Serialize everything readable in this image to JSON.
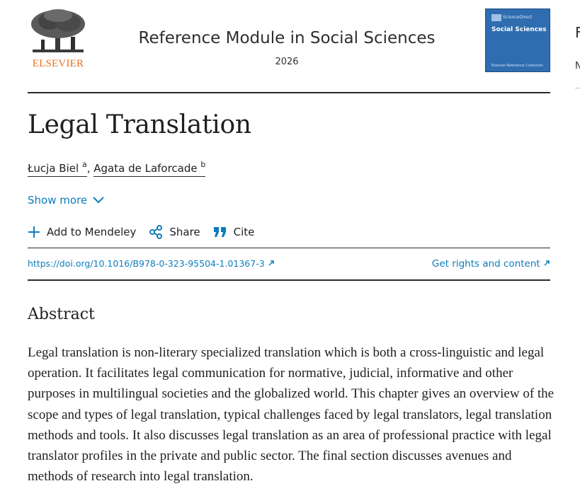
{
  "header": {
    "publisher_logo_text": "ELSEVIER",
    "journal_title": "Reference Module in Social Sciences",
    "year": "2026",
    "cover": {
      "title": "Social Sciences",
      "publisher": "ScienceDirect",
      "collection": "Elsevier Reference Collection"
    },
    "side_heading_initial": "F",
    "side_text_initial": "N"
  },
  "article": {
    "title": "Legal Translation",
    "authors": [
      {
        "name": "Łucja Biel",
        "affiliation": "a"
      },
      {
        "name": "Agata de Laforcade",
        "affiliation": "b"
      }
    ],
    "show_more_label": "Show more",
    "actions": {
      "mendeley": "Add to Mendeley",
      "share": "Share",
      "cite": "Cite"
    },
    "doi_link": "https://doi.org/10.1016/B978-0-323-95504-1.01367-3",
    "rights_link": "Get rights and content"
  },
  "abstract": {
    "heading": "Abstract",
    "body": "Legal translation is non-literary specialized translation which is both a cross-linguistic and legal operation. It facilitates legal communication for normative, judicial, informative and other purposes in multilingual societies and the globalized world. This chapter gives an overview of the scope and types of legal translation, typical challenges faced by legal translators, legal translation methods and tools. It also discusses legal translation as an area of professional practice with legal translator profiles in the private and public sector. The final section discusses avenues and methods of research into legal translation."
  },
  "icons": {
    "logo": "elsevier-tree-logo",
    "chevron": "chevron-down-icon",
    "plus": "plus-icon",
    "share": "share-icon",
    "cite": "quote-icon",
    "external": "external-link-icon"
  },
  "colors": {
    "link": "#0c7dbb",
    "logo_orange": "#e9711c",
    "cover_blue": "#2f6db0",
    "text": "#1f1f1f"
  }
}
